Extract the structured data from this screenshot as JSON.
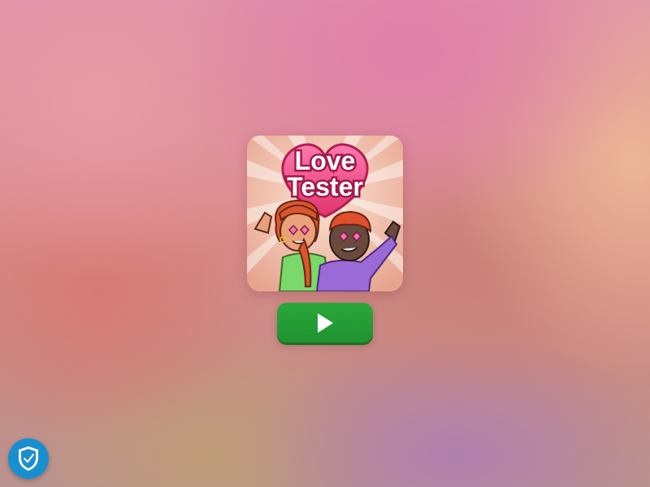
{
  "game": {
    "title_line1": "Love",
    "title_line2": "Tester",
    "thumbnail_icon": "love-tester-thumbnail"
  },
  "play_button": {
    "icon": "play-icon"
  },
  "privacy_badge": {
    "icon": "shield-check-icon"
  },
  "colors": {
    "play_green": "#22a035",
    "heart_pink": "#f05a8c",
    "badge_blue": "#1a8fd0"
  }
}
